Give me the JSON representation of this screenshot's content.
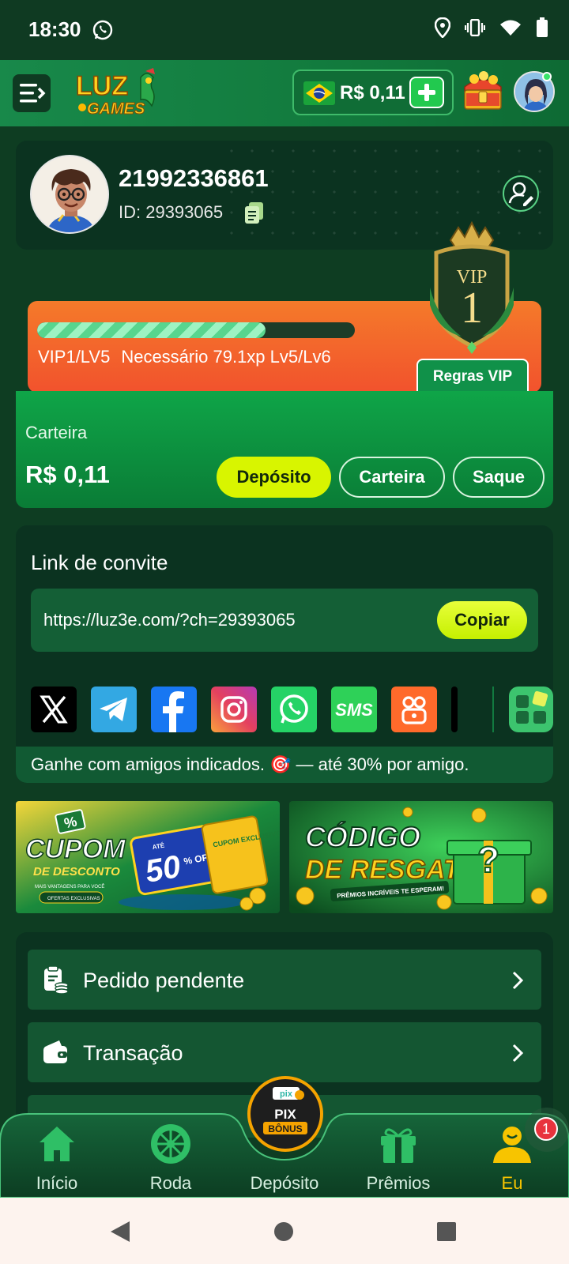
{
  "status_bar": {
    "time": "18:30"
  },
  "header": {
    "logo_text": "LUZ GAMES",
    "balance": "R$ 0,11"
  },
  "profile": {
    "username": "21992336861",
    "id_label": "ID: 29393065"
  },
  "vip": {
    "level_label": "VIP1/LV5",
    "requirement": "Necessário 79.1xp Lv5/Lv6",
    "progress": 0.72,
    "rules_button": "Regras VIP",
    "badge_word": "VIP",
    "badge_level": "1"
  },
  "wallet": {
    "title": "Carteira",
    "amount": "R$ 0,11",
    "deposit_button": "Depósito",
    "wallet_button": "Carteira",
    "withdraw_button": "Saque"
  },
  "invite": {
    "title": "Link de convite",
    "url": "https://luz3e.com/?ch=29393065",
    "copy_button": "Copiar",
    "share_icons": [
      "x-icon",
      "telegram-icon",
      "facebook-icon",
      "instagram-icon",
      "whatsapp-icon",
      "sms-icon",
      "kwai-icon",
      "more-apps-icon"
    ],
    "sms_text": "SMS",
    "footer_text": "Ganhe com amigos indicados. 🎯 — até 30% por amigo."
  },
  "banners": {
    "coupon": {
      "title": "CUPOM",
      "subtitle": "DE DESCONTO",
      "tagline": "MAIS VANTAGENS PARA VOCÊ",
      "chip": "OFERTAS EXCLUSIVAS",
      "up_to": "ATÉ",
      "percent": "50",
      "off": "% OFF",
      "ticket": "CUPOM EXCLUSIVO"
    },
    "code": {
      "title": "CÓDIGO",
      "subtitle": "DE RESGATE",
      "tagline": "PRÊMIOS INCRÍVEIS TE ESPERAM!"
    }
  },
  "menu": {
    "items": [
      {
        "label": "Pedido pendente",
        "icon": "pending-order-icon"
      },
      {
        "label": "Transação",
        "icon": "wallet-transaction-icon"
      }
    ]
  },
  "bottom_nav": {
    "items": [
      {
        "label": "Início",
        "icon": "home-icon"
      },
      {
        "label": "Roda",
        "icon": "wheel-icon"
      },
      {
        "label": "Depósito",
        "icon": "pix-bonus-icon"
      },
      {
        "label": "Prêmios",
        "icon": "gift-icon"
      },
      {
        "label": "Eu",
        "icon": "user-icon"
      }
    ],
    "center_top": "pix",
    "center_line1": "PIX",
    "center_line2": "BÔNUS",
    "notification_count": "1",
    "active_color": "#f7c400"
  }
}
